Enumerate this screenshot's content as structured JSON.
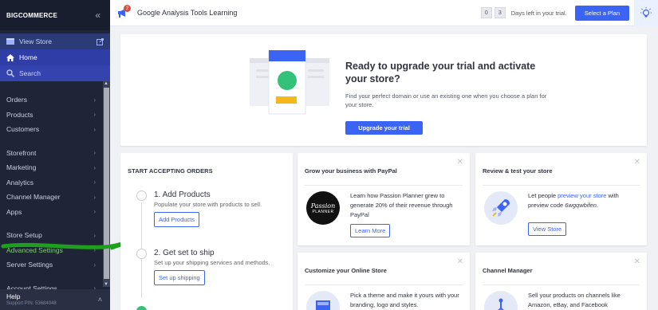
{
  "sidebar": {
    "logo": "BIGCOMMERCE",
    "view_store": "View Store",
    "home": "Home",
    "search": "Search",
    "groups": [
      [
        "Orders",
        "Products",
        "Customers"
      ],
      [
        "Storefront",
        "Marketing",
        "Analytics",
        "Channel Manager",
        "Apps"
      ],
      [
        "Store Setup",
        "Advanced Settings",
        "Server Settings"
      ],
      [
        "Account Settings"
      ]
    ],
    "help": "Help",
    "support_pin": "Support PIN: 53684048"
  },
  "topbar": {
    "notification_count": "2",
    "store_name": "Google Analysis Tools Learning",
    "days_digits": [
      "0",
      "3"
    ],
    "days_text": "Days left in your trial.",
    "select_plan": "Select a Plan"
  },
  "upgrade": {
    "title": "Ready to upgrade your trial and activate your store?",
    "body": "Find your perfect domain or use an existing one when you choose a plan for your store.",
    "button": "Upgrade your trial"
  },
  "orders": {
    "heading": "START ACCEPTING ORDERS",
    "steps": [
      {
        "title": "1. Add Products",
        "desc": "Populate your store with products to sell.",
        "button": "Add Products"
      },
      {
        "title": "2. Get set to ship",
        "desc": "Set up your shipping services and methods.",
        "button": "Set up shipping"
      }
    ]
  },
  "paypal": {
    "heading": "Grow your business with PayPal",
    "logo_line1": "Passion",
    "logo_line2": "PLANNER",
    "text": "Learn how Passion Planner grew to generate 20% of their revenue through PayPal",
    "button": "Learn More"
  },
  "review": {
    "heading": "Review & test your store",
    "text_before": "Let people ",
    "link": "preview your store",
    "text_after": " with preview code ",
    "code": "6wgqwbifen",
    "text_end": ".",
    "button": "View Store"
  },
  "customize": {
    "heading": "Customize your Online Store",
    "text": "Pick a theme and make it yours with your branding, logo and styles."
  },
  "channel": {
    "heading": "Channel Manager",
    "text": "Sell your products on channels like Amazon, eBay, and Facebook"
  },
  "colors": {
    "sidebar_bg": "#1f2437",
    "accent": "#3c64f4",
    "home_bg": "#2f3ea6"
  }
}
